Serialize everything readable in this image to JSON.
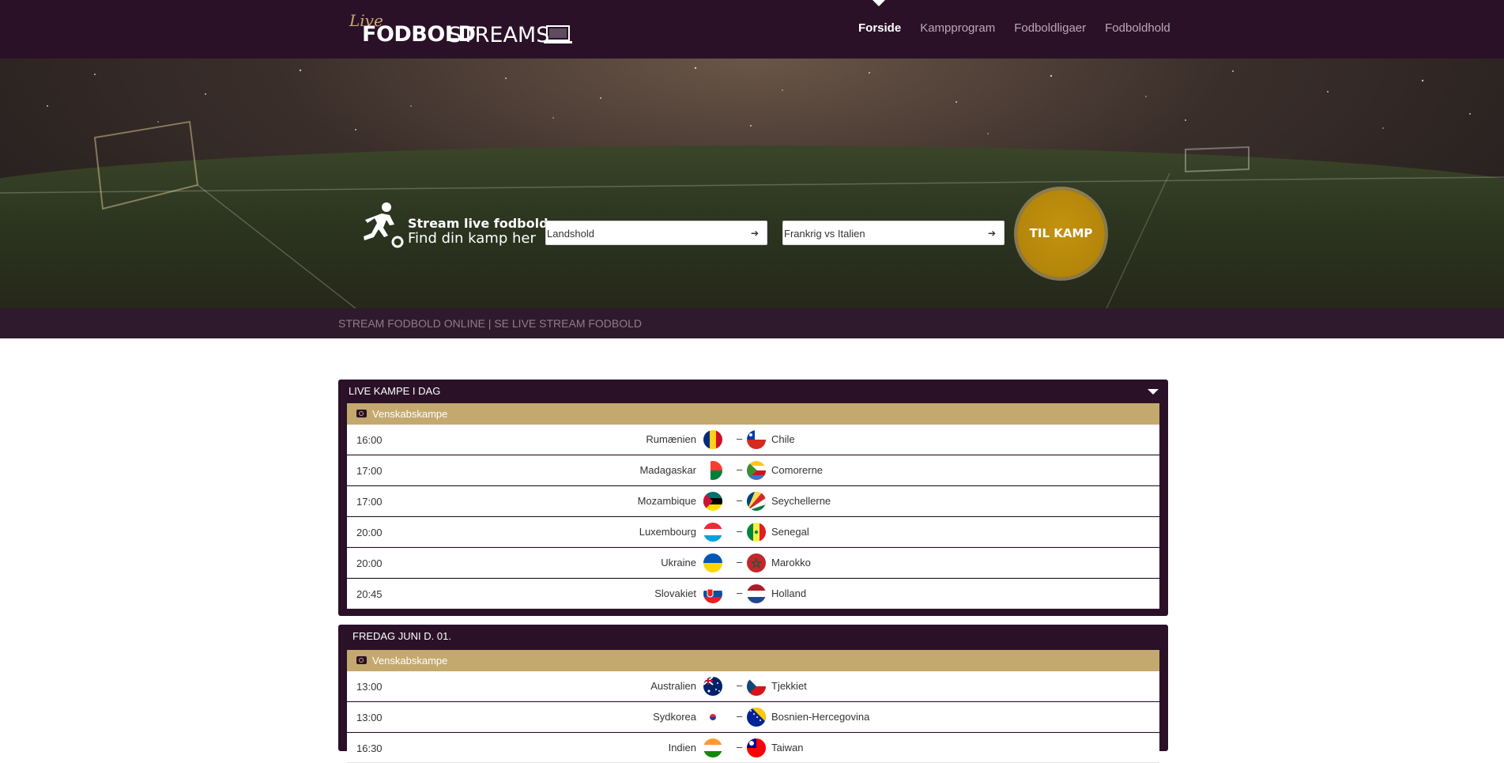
{
  "header": {
    "logo": {
      "live": "Live",
      "fodbold": "FODBOLD",
      "streams": "STREAMS"
    },
    "nav": [
      {
        "label": "Forside",
        "active": true
      },
      {
        "label": "Kampprogram",
        "active": false
      },
      {
        "label": "Fodboldligaer",
        "active": false
      },
      {
        "label": "Fodboldhold",
        "active": false
      }
    ]
  },
  "hero": {
    "tagline_1": "Stream live fodbold",
    "tagline_2": "Find din kamp her",
    "select_1": "Landshold",
    "select_2": "Frankrig vs Italien",
    "go_button": "TIL KAMP"
  },
  "subbar": {
    "text": "STREAM FODBOLD ONLINE | SE LIVE STREAM FODBOLD"
  },
  "panels": [
    {
      "title": "LIVE KAMPE I DAG",
      "league": "Venskabskampe",
      "matches": [
        {
          "time": "16:00",
          "home": "Rumænien",
          "away": "Chile"
        },
        {
          "time": "17:00",
          "home": "Madagaskar",
          "away": "Comorerne"
        },
        {
          "time": "17:00",
          "home": "Mozambique",
          "away": "Seychellerne"
        },
        {
          "time": "20:00",
          "home": "Luxembourg",
          "away": "Senegal"
        },
        {
          "time": "20:00",
          "home": "Ukraine",
          "away": "Marokko"
        },
        {
          "time": "20:45",
          "home": "Slovakiet",
          "away": "Holland"
        }
      ]
    },
    {
      "title": "FREDAG JUNI D. 01.",
      "league": "Venskabskampe",
      "matches": [
        {
          "time": "13:00",
          "home": "Australien",
          "away": "Tjekkiet"
        },
        {
          "time": "13:00",
          "home": "Sydkorea",
          "away": "Bosnien-Hercegovina"
        },
        {
          "time": "16:30",
          "home": "Indien",
          "away": "Taiwan"
        }
      ]
    }
  ],
  "colors": {
    "header_bg": "#2a1128",
    "accent_gold": "#c4a96e",
    "button_gold": "#b3850a"
  }
}
